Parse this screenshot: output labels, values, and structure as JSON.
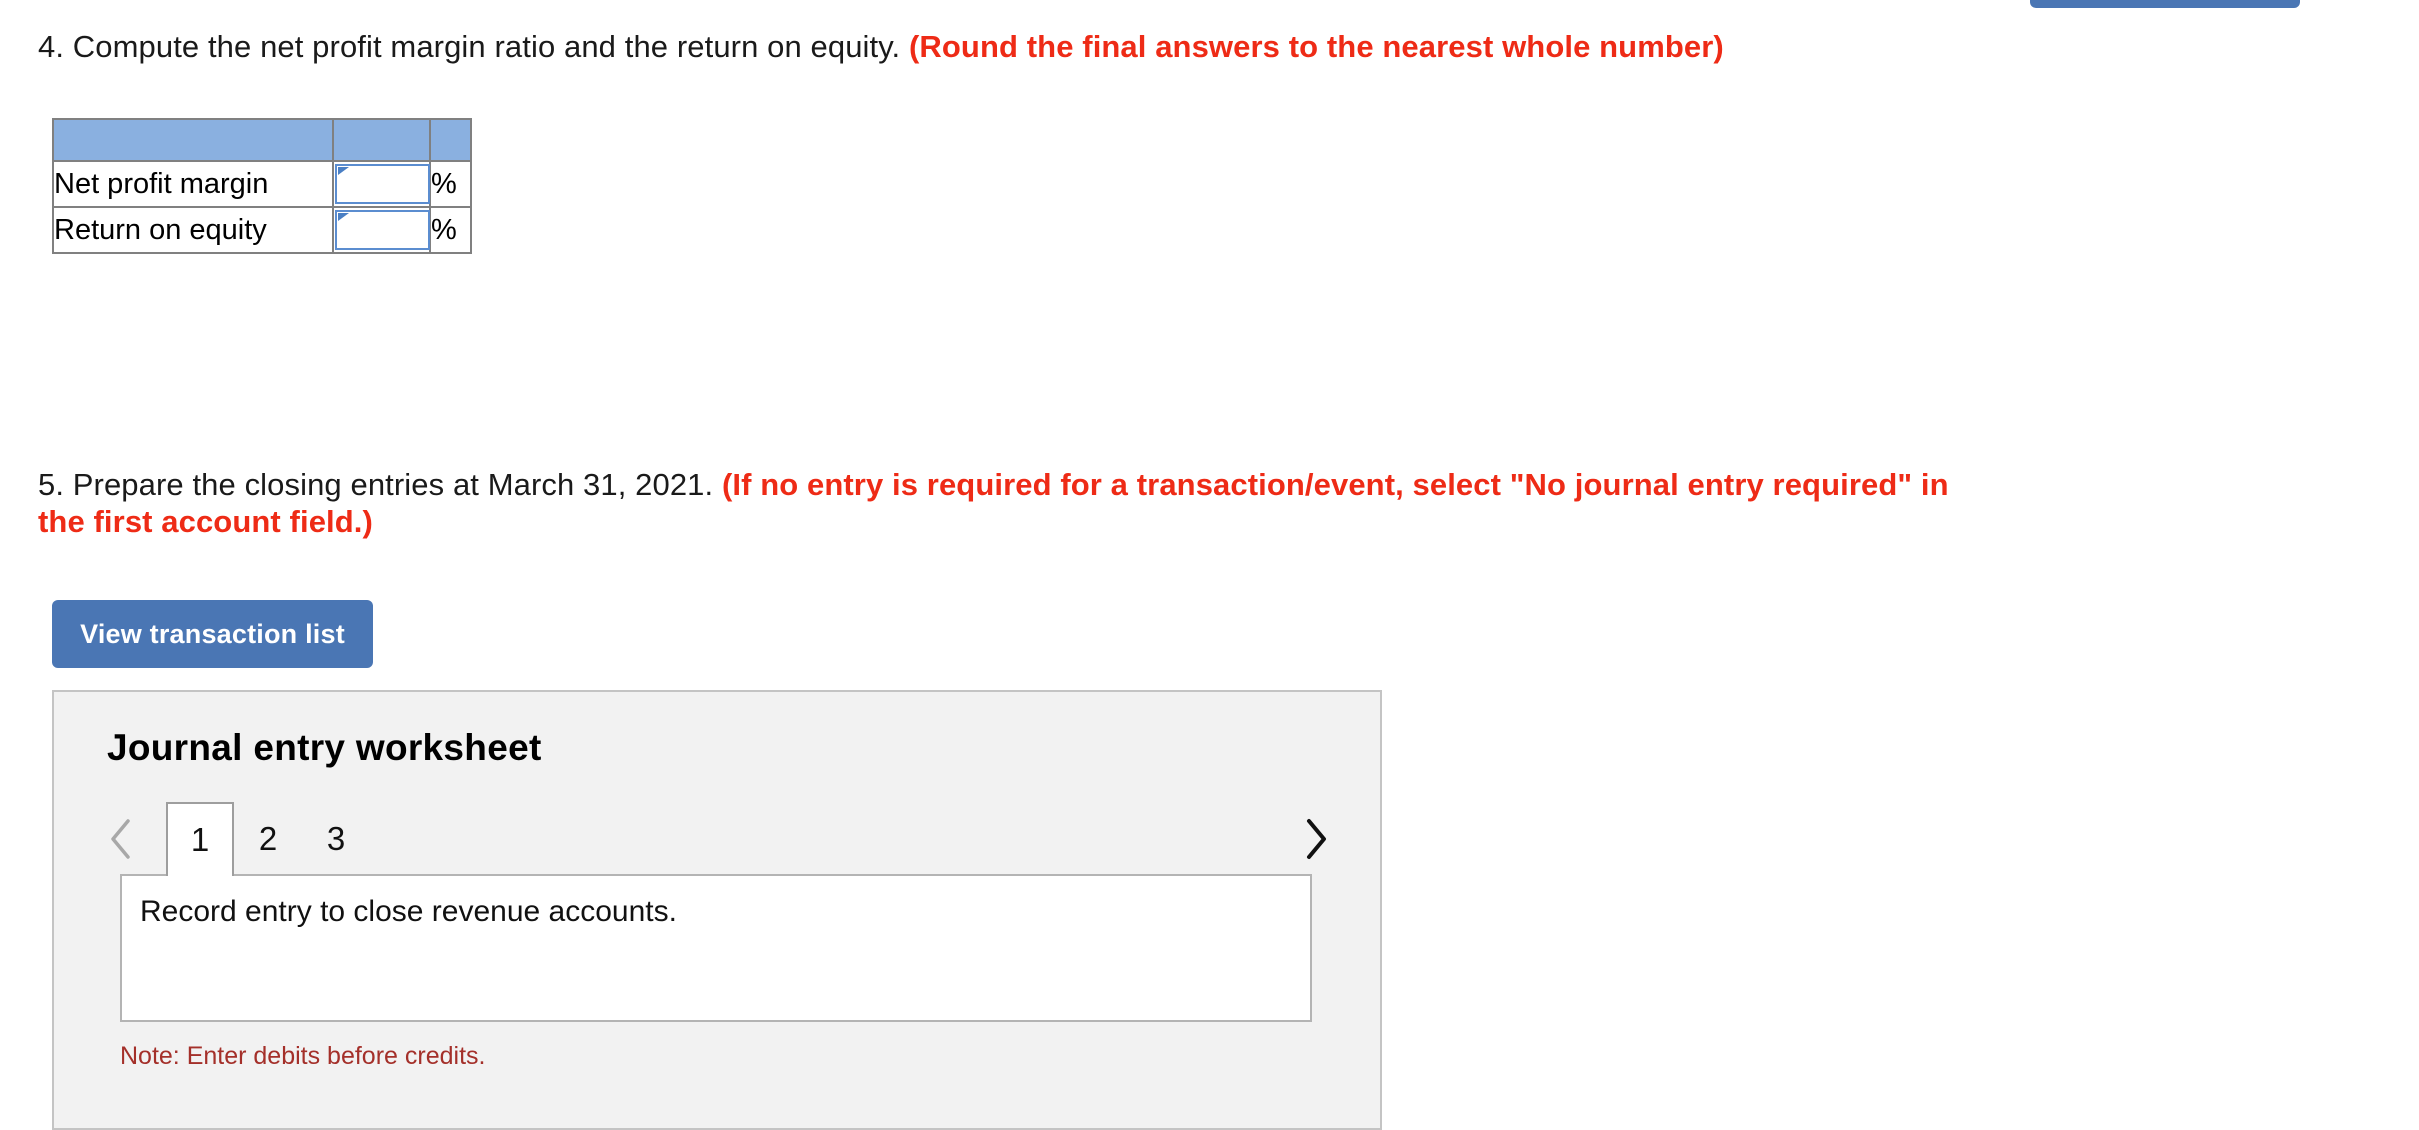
{
  "top_button": {
    "label": "",
    "color": "#4A76B4"
  },
  "question4": {
    "number_and_text": "4. Compute the net profit margin ratio and the return on equity.",
    "instruction": "(Round the final answers to the nearest whole number)"
  },
  "ratio_table": {
    "header": [
      "",
      "",
      ""
    ],
    "rows": [
      {
        "label": "Net profit margin",
        "value": "",
        "unit": "%"
      },
      {
        "label": "Return on equity",
        "value": "",
        "unit": "%"
      }
    ],
    "header_color": "#8AB0E0",
    "input_border_color": "#5B8DD0"
  },
  "question5": {
    "number_and_text": "5. Prepare the closing entries at March 31, 2021.",
    "instruction": "(If no entry is required for a transaction/event, select \"No journal entry required\" in the first account field.)"
  },
  "view_transaction_button": {
    "label": "View transaction list",
    "color": "#4A76B4"
  },
  "worksheet": {
    "title": "Journal entry worksheet",
    "prev_label": "‹",
    "next_label": "›",
    "tabs": [
      {
        "label": "1",
        "active": true
      },
      {
        "label": "2",
        "active": false
      },
      {
        "label": "3",
        "active": false
      }
    ],
    "entry_text": "Record entry to close revenue accounts.",
    "note": "Note: Enter debits before credits.",
    "note_color": "#A4302A",
    "background": "#F2F2F2"
  }
}
